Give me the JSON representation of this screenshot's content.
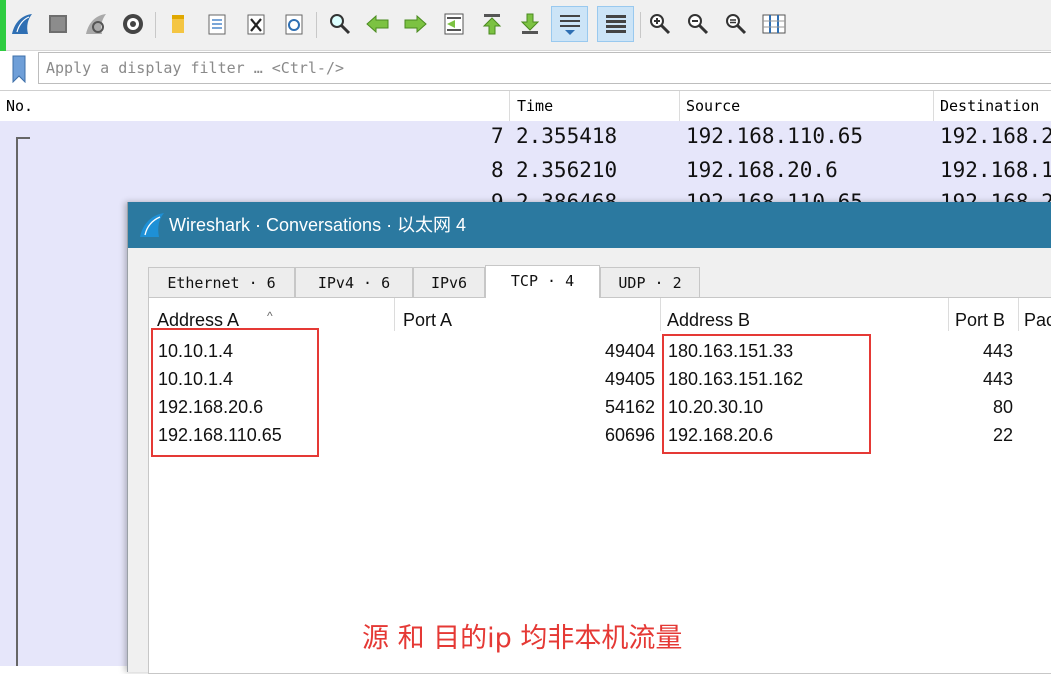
{
  "filter": {
    "placeholder": "Apply a display filter … <Ctrl-/>"
  },
  "packet_list": {
    "columns": [
      "No.",
      "Time",
      "Source",
      "Destination"
    ],
    "rows": [
      {
        "no": "7",
        "time": "2.355418",
        "source": "192.168.110.65",
        "destination": "192.168.2"
      },
      {
        "no": "8",
        "time": "2.356210",
        "source": "192.168.20.6",
        "destination": "192.168.1"
      },
      {
        "no": "9",
        "time": "2.386468",
        "source": "192.168.110.65",
        "destination": "192.168.2"
      }
    ]
  },
  "dialog": {
    "title": "Wireshark · Conversations · 以太网 4",
    "tabs": [
      {
        "label": "Ethernet · 6",
        "active": false
      },
      {
        "label": "IPv4 · 6",
        "active": false
      },
      {
        "label": "IPv6",
        "active": false
      },
      {
        "label": "TCP · 4",
        "active": true
      },
      {
        "label": "UDP · 2",
        "active": false
      }
    ],
    "columns": [
      "Address A",
      "Port A",
      "Address B",
      "Port B",
      "Packets"
    ],
    "rows": [
      {
        "address_a": "10.10.1.4",
        "port_a": "49404",
        "address_b": "180.163.151.33",
        "port_b": "443"
      },
      {
        "address_a": "10.10.1.4",
        "port_a": "49405",
        "address_b": "180.163.151.162",
        "port_b": "443"
      },
      {
        "address_a": "192.168.20.6",
        "port_a": "54162",
        "address_b": "10.20.30.10",
        "port_b": "80"
      },
      {
        "address_a": "192.168.110.65",
        "port_a": "60696",
        "address_b": "192.168.20.6",
        "port_b": "22"
      }
    ]
  },
  "annotation": {
    "text": "源 和 目的ip 均非本机流量",
    "color": "#e53935"
  },
  "colors": {
    "title_bar": "#2b79a0",
    "packet_row_bg": "#e6e6fa",
    "accent_green": "#2ecc40",
    "highlight_box": "#e53935"
  },
  "toolbar": {
    "icons": [
      "start-capture-icon",
      "stop-capture-icon",
      "restart-capture-icon",
      "capture-options-icon",
      "open-file-icon",
      "save-file-icon",
      "close-file-icon",
      "reload-file-icon",
      "find-packet-icon",
      "go-back-icon",
      "go-forward-icon",
      "go-to-packet-icon",
      "go-first-icon",
      "go-last-icon",
      "auto-scroll-icon",
      "colorize-icon",
      "zoom-in-icon",
      "zoom-out-icon",
      "normal-size-icon",
      "resize-columns-icon"
    ]
  }
}
